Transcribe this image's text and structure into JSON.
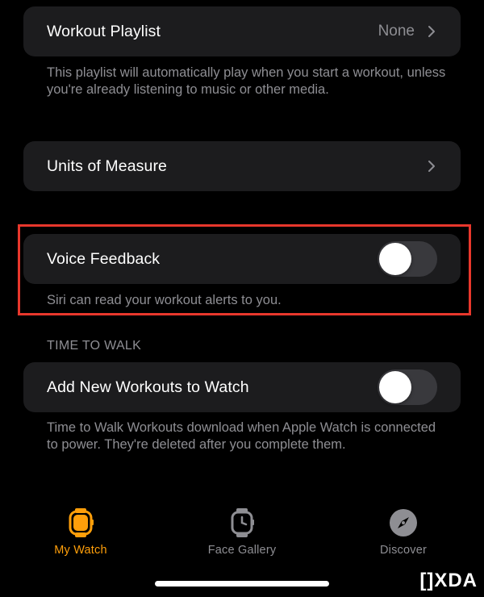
{
  "workout_playlist": {
    "label": "Workout Playlist",
    "value": "None",
    "footnote": "This playlist will automatically play when you start a workout, unless you're already listening to music or other media."
  },
  "units_of_measure": {
    "label": "Units of Measure"
  },
  "voice_feedback": {
    "label": "Voice Feedback",
    "enabled": false,
    "footnote": "Siri can read your workout alerts to you."
  },
  "time_to_walk": {
    "header": "TIME TO WALK",
    "label": "Add New Workouts to Watch",
    "enabled": false,
    "footnote": "Time to Walk Workouts download when Apple Watch is connected to power. They're deleted after you complete them."
  },
  "tab_bar": {
    "items": [
      {
        "label": "My Watch",
        "icon": "watch-face-icon",
        "selected": true
      },
      {
        "label": "Face Gallery",
        "icon": "watch-icon",
        "selected": false
      },
      {
        "label": "Discover",
        "icon": "compass-icon",
        "selected": false
      }
    ]
  },
  "colors": {
    "background": "#000000",
    "cell": "#1c1c1e",
    "secondary_text": "#8e8e93",
    "accent": "#ff9f0a",
    "highlight": "#e8372c",
    "toggle_off": "#39393d"
  },
  "watermark": "[]XDA"
}
